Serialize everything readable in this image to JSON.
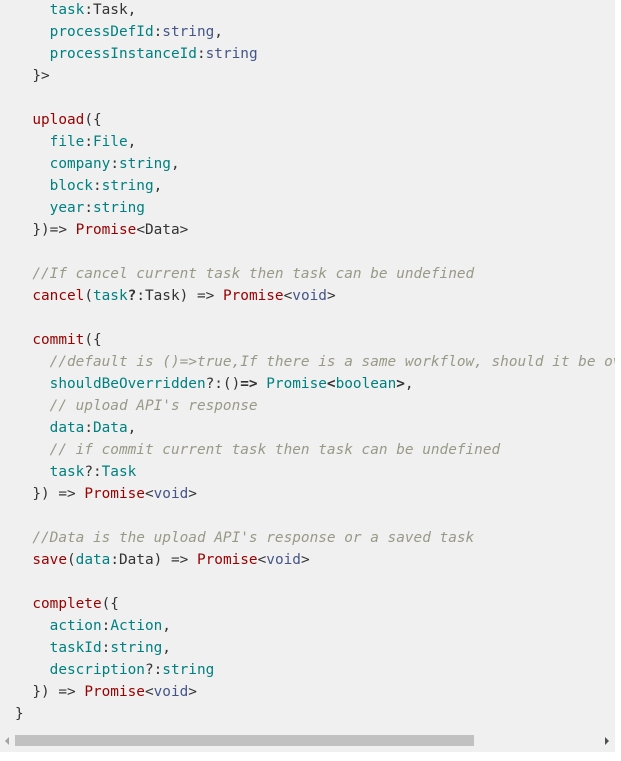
{
  "code": {
    "lines": [
      [
        {
          "t": "    "
        },
        {
          "t": "task",
          "c": "prop"
        },
        {
          "t": ":"
        },
        {
          "t": "Task"
        },
        {
          "t": ","
        }
      ],
      [
        {
          "t": "    "
        },
        {
          "t": "processDefId",
          "c": "prop"
        },
        {
          "t": ":"
        },
        {
          "t": "string",
          "c": "type"
        },
        {
          "t": ","
        }
      ],
      [
        {
          "t": "    "
        },
        {
          "t": "processInstanceId",
          "c": "prop"
        },
        {
          "t": ":"
        },
        {
          "t": "string",
          "c": "type"
        }
      ],
      [
        {
          "t": "  }>"
        }
      ],
      [
        {
          "t": ""
        }
      ],
      [
        {
          "t": "  "
        },
        {
          "t": "upload",
          "c": "fn"
        },
        {
          "t": "({"
        }
      ],
      [
        {
          "t": "    "
        },
        {
          "t": "file",
          "c": "prop"
        },
        {
          "t": ":"
        },
        {
          "t": "File",
          "c": "prop"
        },
        {
          "t": ","
        }
      ],
      [
        {
          "t": "    "
        },
        {
          "t": "company",
          "c": "prop"
        },
        {
          "t": ":"
        },
        {
          "t": "string",
          "c": "prop"
        },
        {
          "t": ","
        }
      ],
      [
        {
          "t": "    "
        },
        {
          "t": "block",
          "c": "prop"
        },
        {
          "t": ":"
        },
        {
          "t": "string",
          "c": "prop"
        },
        {
          "t": ","
        }
      ],
      [
        {
          "t": "    "
        },
        {
          "t": "year",
          "c": "prop"
        },
        {
          "t": ":"
        },
        {
          "t": "string",
          "c": "prop"
        }
      ],
      [
        {
          "t": "  })=> "
        },
        {
          "t": "Promise",
          "c": "fn"
        },
        {
          "t": "<Data>"
        }
      ],
      [
        {
          "t": ""
        }
      ],
      [
        {
          "t": "  "
        },
        {
          "t": "//If cancel current task then task can be undefined",
          "c": "com"
        }
      ],
      [
        {
          "t": "  "
        },
        {
          "t": "cancel",
          "c": "fn"
        },
        {
          "t": "("
        },
        {
          "t": "task",
          "c": "prop"
        },
        {
          "t": "?",
          "c": "kw"
        },
        {
          "t": ":Task) => "
        },
        {
          "t": "Promise",
          "c": "fn"
        },
        {
          "t": "<"
        },
        {
          "t": "void",
          "c": "type"
        },
        {
          "t": ">"
        }
      ],
      [
        {
          "t": ""
        }
      ],
      [
        {
          "t": "  "
        },
        {
          "t": "commit",
          "c": "fn"
        },
        {
          "t": "({"
        }
      ],
      [
        {
          "t": "    "
        },
        {
          "t": "//default is ()=>true,If there is a same workflow, should it be overridden",
          "c": "com"
        }
      ],
      [
        {
          "t": "    "
        },
        {
          "t": "shouldBeOverridden",
          "c": "prop"
        },
        {
          "t": "?:()"
        },
        {
          "t": "=>",
          "c": "kw"
        },
        {
          "t": " "
        },
        {
          "t": "Promise",
          "c": "prop"
        },
        {
          "t": "<",
          "c": "kw"
        },
        {
          "t": "boolean",
          "c": "prop"
        },
        {
          "t": ">",
          "c": "kw"
        },
        {
          "t": ","
        }
      ],
      [
        {
          "t": "    "
        },
        {
          "t": "// upload API's response",
          "c": "com"
        }
      ],
      [
        {
          "t": "    "
        },
        {
          "t": "data",
          "c": "prop"
        },
        {
          "t": ":"
        },
        {
          "t": "Data",
          "c": "prop"
        },
        {
          "t": ","
        }
      ],
      [
        {
          "t": "    "
        },
        {
          "t": "// if commit current task then task can be undefined",
          "c": "com"
        }
      ],
      [
        {
          "t": "    "
        },
        {
          "t": "task",
          "c": "prop"
        },
        {
          "t": "?:"
        },
        {
          "t": "Task",
          "c": "prop"
        }
      ],
      [
        {
          "t": "  }) => "
        },
        {
          "t": "Promise",
          "c": "fn"
        },
        {
          "t": "<"
        },
        {
          "t": "void",
          "c": "type"
        },
        {
          "t": ">"
        }
      ],
      [
        {
          "t": ""
        }
      ],
      [
        {
          "t": "  "
        },
        {
          "t": "//Data is the upload API's response or a saved task",
          "c": "com"
        }
      ],
      [
        {
          "t": "  "
        },
        {
          "t": "save",
          "c": "fn"
        },
        {
          "t": "("
        },
        {
          "t": "data",
          "c": "prop"
        },
        {
          "t": ":Data) => "
        },
        {
          "t": "Promise",
          "c": "fn"
        },
        {
          "t": "<"
        },
        {
          "t": "void",
          "c": "type"
        },
        {
          "t": ">"
        }
      ],
      [
        {
          "t": ""
        }
      ],
      [
        {
          "t": "  "
        },
        {
          "t": "complete",
          "c": "fn"
        },
        {
          "t": "({"
        }
      ],
      [
        {
          "t": "    "
        },
        {
          "t": "action",
          "c": "prop"
        },
        {
          "t": ":"
        },
        {
          "t": "Action",
          "c": "prop"
        },
        {
          "t": ","
        }
      ],
      [
        {
          "t": "    "
        },
        {
          "t": "taskId",
          "c": "prop"
        },
        {
          "t": ":"
        },
        {
          "t": "string",
          "c": "prop"
        },
        {
          "t": ","
        }
      ],
      [
        {
          "t": "    "
        },
        {
          "t": "description",
          "c": "prop"
        },
        {
          "t": "?:"
        },
        {
          "t": "string",
          "c": "prop"
        }
      ],
      [
        {
          "t": "  }) => "
        },
        {
          "t": "Promise",
          "c": "fn"
        },
        {
          "t": "<"
        },
        {
          "t": "void",
          "c": "type"
        },
        {
          "t": ">"
        }
      ],
      [
        {
          "t": "}"
        }
      ]
    ]
  },
  "scrollbar": {
    "position_fraction": 0.0,
    "visible_fraction": 0.78
  }
}
